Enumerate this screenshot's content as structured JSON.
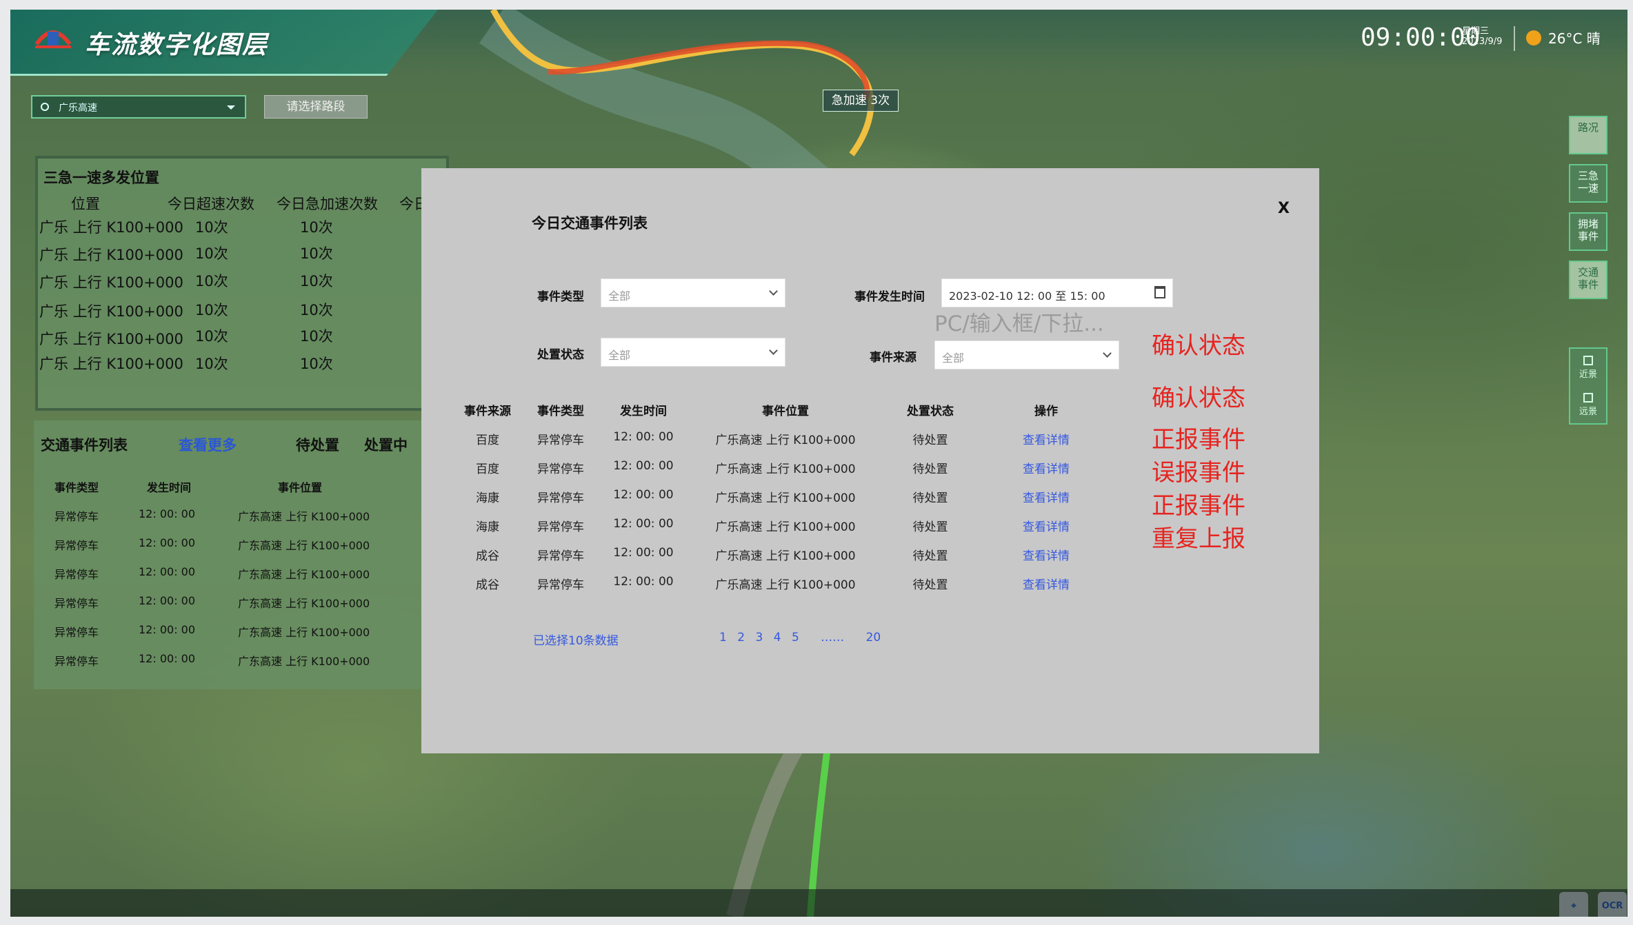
{
  "header": {
    "title": "车流数字化图层",
    "time": "09:00:00",
    "weekday": "星期三",
    "date": "2023/9/9",
    "weather": "26°C 晴"
  },
  "map": {
    "accel_tag": "急加速 3次"
  },
  "filters": {
    "road": "广乐高速",
    "segment_button": "请选择路段"
  },
  "hot_panel": {
    "title": "三急一速多发位置",
    "columns": [
      "位置",
      "今日超速次数",
      "今日急加速次数",
      "今日"
    ],
    "rows": [
      [
        "广乐 上行 K100+000",
        "10次",
        "10次"
      ],
      [
        "广乐 上行 K100+000",
        "10次",
        "10次"
      ],
      [
        "广乐 上行 K100+000",
        "10次",
        "10次"
      ],
      [
        "广乐 上行 K100+000",
        "10次",
        "10次"
      ],
      [
        "广乐 上行 K100+000",
        "10次",
        "10次"
      ],
      [
        "广乐 上行 K100+000",
        "10次",
        "10次"
      ]
    ]
  },
  "events_panel": {
    "title": "交通事件列表",
    "more": "查看更多",
    "tabs": [
      "待处置",
      "处置中"
    ],
    "columns": [
      "事件类型",
      "发生时间",
      "事件位置"
    ],
    "rows": [
      [
        "异常停车",
        "12: 00: 00",
        "广东高速 上行 K100+000"
      ],
      [
        "异常停车",
        "12: 00: 00",
        "广东高速 上行 K100+000"
      ],
      [
        "异常停车",
        "12: 00: 00",
        "广东高速 上行 K100+000"
      ],
      [
        "异常停车",
        "12: 00: 00",
        "广东高速 上行 K100+000"
      ],
      [
        "异常停车",
        "12: 00: 00",
        "广东高速 上行 K100+000"
      ],
      [
        "异常停车",
        "12: 00: 00",
        "广东高速 上行 K100+000"
      ]
    ]
  },
  "rail": {
    "items": [
      "路况",
      "三急\n一速",
      "拥堵\n事件",
      "交通\n事件"
    ],
    "group": [
      "近景",
      "远景"
    ]
  },
  "corner": {
    "screenshot": "⌖",
    "ocr": "OCR"
  },
  "modal": {
    "title": "今日交通事件列表",
    "close": "X",
    "event_type_label": "事件类型",
    "event_type_value": "全部",
    "time_label": "事件发生时间",
    "time_value": "2023-02-10 12: 00 至 15: 00",
    "status_label": "处置状态",
    "status_value": "全部",
    "source_label": "事件来源",
    "source_value": "全部",
    "hint": "PC/输入框/下拉...",
    "columns": [
      "事件来源",
      "事件类型",
      "发生时间",
      "事件位置",
      "处置状态",
      "操作"
    ],
    "rows": [
      [
        "百度",
        "异常停车",
        "12: 00: 00",
        "广乐高速 上行 K100+000",
        "待处置",
        "查看详情"
      ],
      [
        "百度",
        "异常停车",
        "12: 00: 00",
        "广乐高速 上行 K100+000",
        "待处置",
        "查看详情"
      ],
      [
        "海康",
        "异常停车",
        "12: 00: 00",
        "广乐高速 上行 K100+000",
        "待处置",
        "查看详情"
      ],
      [
        "海康",
        "异常停车",
        "12: 00: 00",
        "广乐高速 上行 K100+000",
        "待处置",
        "查看详情"
      ],
      [
        "成谷",
        "异常停车",
        "12: 00: 00",
        "广乐高速 上行 K100+000",
        "待处置",
        "查看详情"
      ],
      [
        "成谷",
        "异常停车",
        "12: 00: 00",
        "广乐高速 上行 K100+000",
        "待处置",
        "查看详情"
      ]
    ],
    "selected_count": "已选择10条数据",
    "pages": [
      "1",
      "2",
      "3",
      "4",
      "5",
      "……",
      "20"
    ]
  },
  "annotations": [
    "确认状态",
    "确认状态",
    "正报事件",
    "误报事件",
    "正报事件",
    "重复上报"
  ],
  "colors": {
    "accent": "#3558e0",
    "annotation": "#e62420",
    "panel": "#688f64",
    "modal": "#c8c8c8"
  }
}
